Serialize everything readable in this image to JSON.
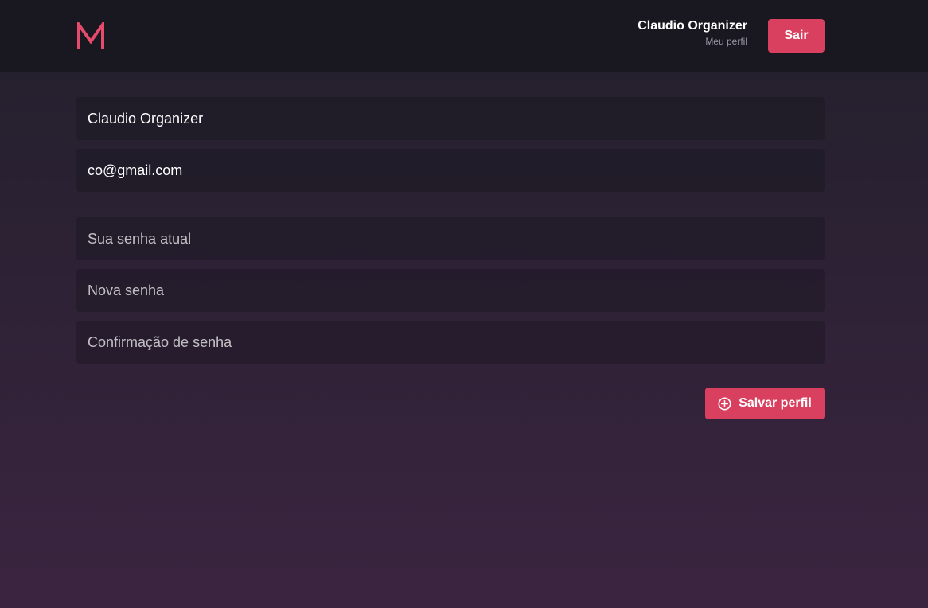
{
  "header": {
    "logo_text": "M",
    "user_name": "Claudio Organizer",
    "profile_link": "Meu perfil",
    "logout_label": "Sair"
  },
  "form": {
    "name_value": "Claudio Organizer",
    "email_value": "co@gmail.com",
    "current_password_placeholder": "Sua senha atual",
    "new_password_placeholder": "Nova senha",
    "confirm_password_placeholder": "Confirmação de senha",
    "save_label": "Salvar perfil"
  },
  "icons": {
    "logo": "m-logo-icon",
    "save": "plus-circle-icon"
  },
  "colors": {
    "accent": "#d9405f",
    "header_background": "#191720",
    "background_top": "#22202c",
    "background_bottom": "#3b2440"
  }
}
